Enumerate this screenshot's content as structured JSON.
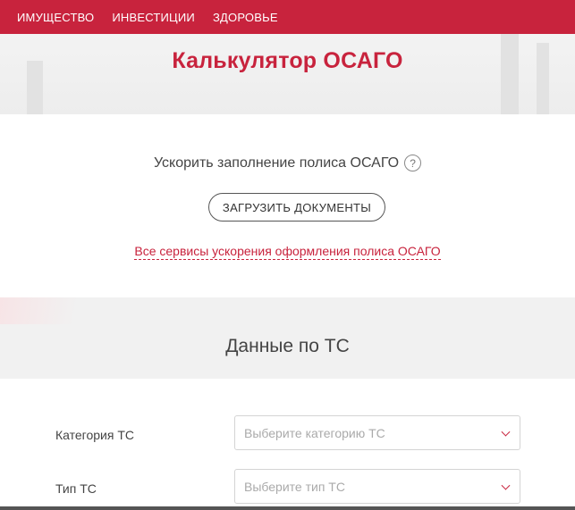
{
  "topnav": {
    "items": [
      {
        "label": "ИМУЩЕСТВО"
      },
      {
        "label": "ИНВЕСТИЦИИ"
      },
      {
        "label": "ЗДОРОВЬЕ"
      }
    ]
  },
  "hero": {
    "title": "Калькулятор ОСАГО"
  },
  "speed": {
    "text": "Ускорить заполнение полиса ОСАГО",
    "help_icon_glyph": "?",
    "upload_label": "ЗАГРУЗИТЬ ДОКУМЕНТЫ",
    "services_link": "Все сервисы ускорения оформления полиса ОСАГО"
  },
  "vehicle_section": {
    "title": "Данные по ТС"
  },
  "form": {
    "category": {
      "label": "Категория ТС",
      "placeholder": "Выберите категорию ТС"
    },
    "type": {
      "label": "Тип ТС",
      "placeholder": "Выберите тип ТС"
    }
  },
  "colors": {
    "brand": "#c8233d",
    "section_bg": "#f1f1f1"
  },
  "icons": {
    "help": "question-circle-icon",
    "select_arrow": "chevron-down-icon"
  }
}
